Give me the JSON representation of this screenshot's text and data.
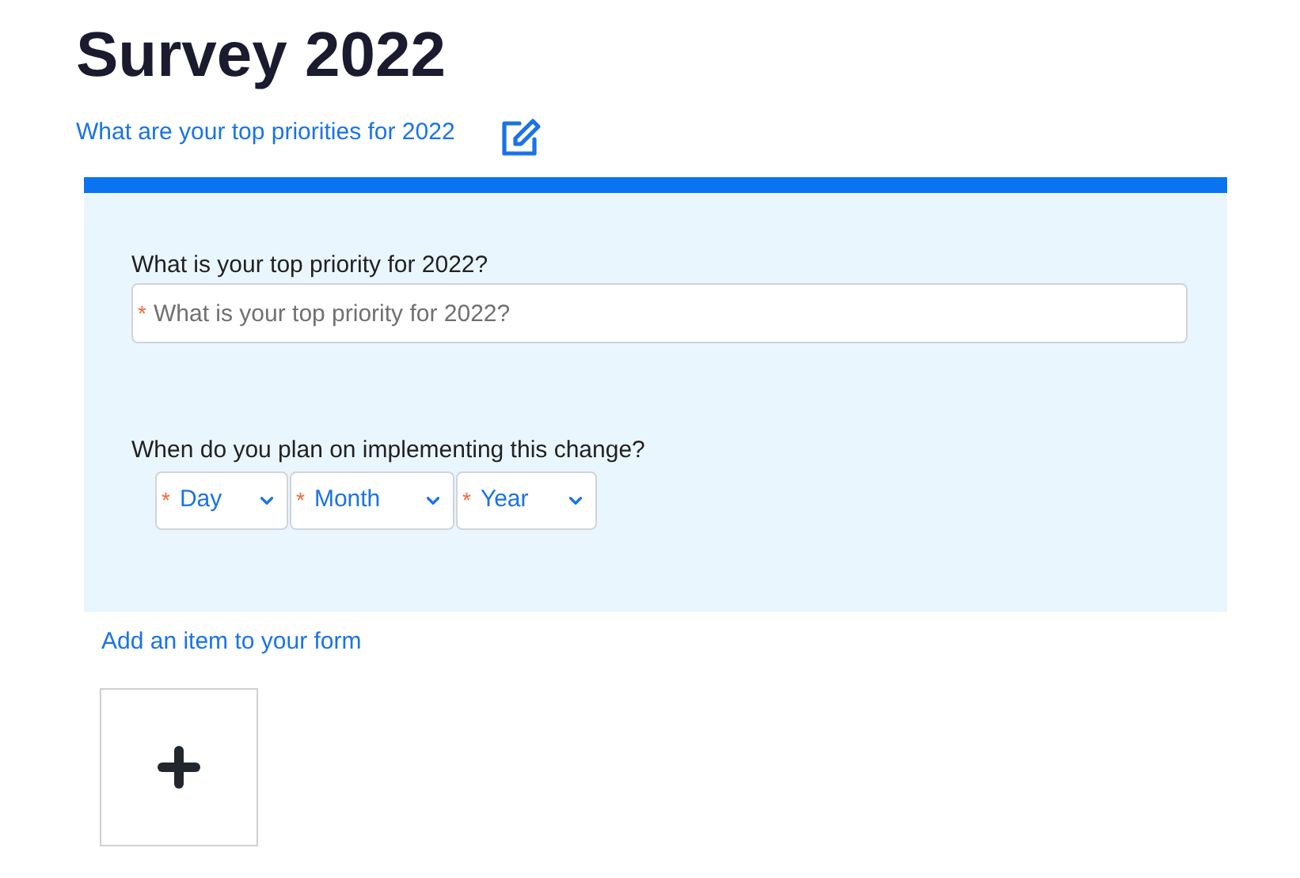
{
  "title": "Survey 2022",
  "subtitle": "What are your top priorities for 2022",
  "questions": [
    {
      "kind": "text",
      "label": "What is your top priority for 2022?",
      "fields": [
        {
          "mark": "*",
          "placeholder": "What is your top priority for 2022?"
        }
      ]
    },
    {
      "kind": "date",
      "label": "When do you plan on implementing this change?",
      "fields": [
        {
          "mark": "*",
          "value": "Day"
        },
        {
          "mark": "*",
          "value": "Month"
        },
        {
          "mark": "*",
          "value": "Year"
        }
      ]
    }
  ],
  "add_link": "Add an item to your form"
}
